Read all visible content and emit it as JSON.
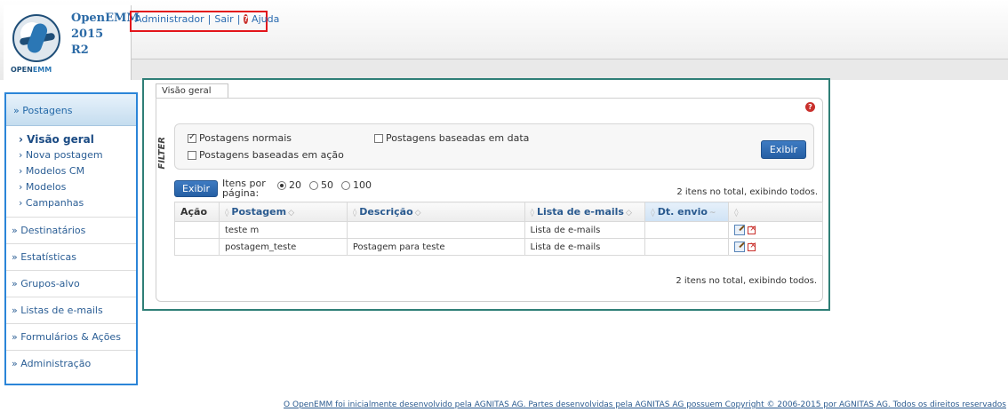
{
  "header": {
    "app_title_line1": "OpenEMM",
    "app_title_line2": "2015",
    "app_title_line3": "R2",
    "logo_text_a": "OPEN",
    "logo_text_b": "EMM",
    "user": "Administrador",
    "logout": "Sair",
    "help": "Ajuda"
  },
  "sidebar": {
    "active_section": "Postagens",
    "sub_items": [
      "Visão geral",
      "Nova postagem",
      "Modelos CM",
      "Modelos",
      "Campanhas"
    ],
    "items": [
      "Destinatários",
      "Estatísticas",
      "Grupos-alvo",
      "Listas de e-mails",
      "Formulários & Ações",
      "Administração"
    ]
  },
  "main": {
    "tab": "Visão geral",
    "filter": {
      "label": "FILTER",
      "opt_normal": "Postagens normais",
      "opt_date": "Postagens baseadas em data",
      "opt_action": "Postagens baseadas em ação",
      "button": "Exibir"
    },
    "paging": {
      "button": "Exibir",
      "label": "Itens por página:",
      "opt_20": "20",
      "opt_50": "50",
      "opt_100": "100",
      "count": "2 itens no total, exibindo todos."
    },
    "table": {
      "headers": [
        "Ação",
        "Postagem",
        "Descrição",
        "Lista de e-mails",
        "Dt. envio"
      ],
      "rows": [
        {
          "postagem": "teste m",
          "descricao": "",
          "lista": "Lista de e-mails",
          "dt": ""
        },
        {
          "postagem": "postagem_teste",
          "descricao": "Postagem para teste",
          "lista": "Lista de e-mails",
          "dt": ""
        }
      ]
    },
    "count_bottom": "2 itens no total, exibindo todos."
  },
  "footer": "O OpenEMM foi inicialmente desenvolvido pela AGNITAS AG. Partes desenvolvidas pela AGNITAS AG possuem Copyright © 2006-2015 por AGNITAS AG. Todos os direitos reservados",
  "colors": {
    "accent": "#2b85d8",
    "frame_highlight": "#2f7f77",
    "top_links_highlight": "#e3151b"
  }
}
